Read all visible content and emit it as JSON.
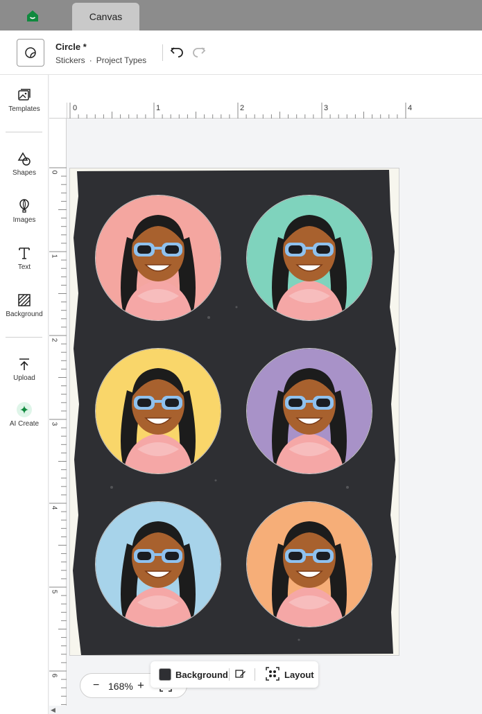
{
  "tabbar": {
    "tab_label": "Canvas"
  },
  "header": {
    "title": "Circle *",
    "crumb_1": "Stickers",
    "crumb_sep": "·",
    "crumb_2": "Project Types"
  },
  "sidebar": {
    "templates": "Templates",
    "shapes": "Shapes",
    "images": "Images",
    "text": "Text",
    "background": "Background",
    "upload": "Upload",
    "ai_create": "AI Create"
  },
  "rulers": {
    "top_labels": [
      "0",
      "1",
      "2",
      "3",
      "4"
    ],
    "left_labels": [
      "0",
      "1",
      "2",
      "3",
      "4",
      "5",
      "6"
    ]
  },
  "canvas": {
    "stickers": [
      {
        "bg": "#f4a6a0"
      },
      {
        "bg": "#7fd3bd"
      },
      {
        "bg": "#f9d66a"
      },
      {
        "bg": "#a892c8"
      },
      {
        "bg": "#a7d3ea"
      },
      {
        "bg": "#f6ae78"
      }
    ]
  },
  "zoom": {
    "minus": "−",
    "value": "168%",
    "plus": "+"
  },
  "context_bar": {
    "background_label": "Background",
    "layout_label": "Layout"
  },
  "colors": {
    "brand_green": "#10893e",
    "page_dark": "#2e2f33",
    "skin": "#a8612e",
    "dress": "#f5a7a6",
    "glasses": "#8fc1ee"
  }
}
